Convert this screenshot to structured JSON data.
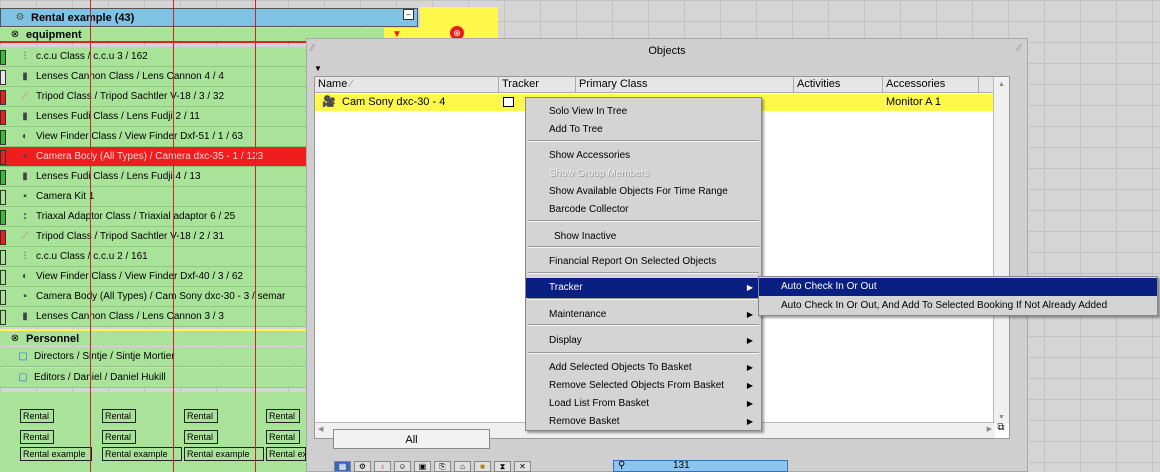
{
  "tree": {
    "header": {
      "label": "Rental example (43)"
    },
    "group_equipment": {
      "label": "equipment"
    },
    "items": [
      {
        "label": "c.c.u Class / c.c.u 3 / 162",
        "icon": "ccu-icon"
      },
      {
        "label": "Lenses Cannon Class / Lens Cannon 4 / 4",
        "icon": "lens-icon"
      },
      {
        "label": "Tripod Class / Tripod Sachtler V-18 / 3 / 32",
        "icon": "tripod-icon"
      },
      {
        "label": "Lenses Fudi Class / Lens Fudji 2 / 11",
        "icon": "lens-icon"
      },
      {
        "label": "View Finder Class / View Finder Dxf-51 / 1 / 63",
        "icon": "viewfinder-icon"
      },
      {
        "label": "Camera Body (All Types) / Camera dxc-35 - 1 / 123",
        "icon": "camera-icon"
      },
      {
        "label": "Lenses Fudi Class / Lens Fudji 4 / 13",
        "icon": "lens-icon"
      },
      {
        "label": "Camera Kit 1",
        "icon": "camera-icon"
      },
      {
        "label": "Triaxal Adaptor Class / Triaxial adaptor 6 / 25",
        "icon": "adaptor-icon"
      },
      {
        "label": "Tripod Class / Tripod Sachtler V-18 / 2 / 31",
        "icon": "tripod-icon"
      },
      {
        "label": "c.c.u Class / c.c.u 2 / 161",
        "icon": "ccu-icon"
      },
      {
        "label": "View Finder Class / View Finder Dxf-40 / 3 / 62",
        "icon": "viewfinder-icon"
      },
      {
        "label": "Camera Body (All Types) / Cam Sony dxc-30 - 3 / semar",
        "icon": "camera-icon"
      },
      {
        "label": "Lenses Cannon Class / Lens Cannon 3 / 3",
        "icon": "lens-icon"
      }
    ],
    "group_personnel": {
      "label": "Personnel"
    },
    "personnel": [
      {
        "label": "Directors / Sintje / Sintje Mortier",
        "icon": "person-icon"
      },
      {
        "label": "Editors / Daniel / Daniel Hukill",
        "icon": "person-icon"
      }
    ],
    "chart_cells": {
      "short": "Rental",
      "long": "Rental example"
    }
  },
  "dialog": {
    "title": "Objects",
    "columns": [
      "Name",
      "Tracker",
      "Primary Class",
      "Activities",
      "Accessories"
    ],
    "row": {
      "name": "Cam Sony dxc-30 - 4",
      "accessories": "Monitor A 1"
    },
    "all_button": "All",
    "search_value": "131"
  },
  "context_menu": {
    "items": [
      {
        "label": "Solo View In Tree",
        "submenu": false
      },
      {
        "label": "Add To Tree",
        "submenu": false
      },
      {
        "label": "Show Accessories",
        "submenu": false
      },
      {
        "label": "Show Group Members",
        "submenu": false,
        "disabled": true
      },
      {
        "label": "Show Available Objects For Time Range",
        "submenu": false
      },
      {
        "label": "Barcode Collector",
        "submenu": false
      },
      {
        "label": "Show Inactive",
        "submenu": false
      },
      {
        "label": "Financial Report On Selected Objects",
        "submenu": false
      },
      {
        "label": "Tracker",
        "submenu": true,
        "selected": true
      },
      {
        "label": "Maintenance",
        "submenu": true
      },
      {
        "label": "Display",
        "submenu": true
      },
      {
        "label": "Add Selected Objects To Basket",
        "submenu": true
      },
      {
        "label": "Remove Selected Objects From Basket",
        "submenu": true
      },
      {
        "label": "Load List From Basket",
        "submenu": true
      },
      {
        "label": "Remove Basket",
        "submenu": true
      }
    ]
  },
  "tracker_submenu": {
    "items": [
      {
        "label": "Auto Check In Or Out",
        "selected": true
      },
      {
        "label": "Auto Check In Or Out, And Add To Selected Booking If Not Already Added"
      }
    ]
  },
  "colors": {
    "row_green": "#a9e39a",
    "header_blue": "#7ec3e3",
    "highlight_red": "#ef1d1d",
    "yellow": "#fff84a",
    "menu_select": "#0a1f82"
  }
}
